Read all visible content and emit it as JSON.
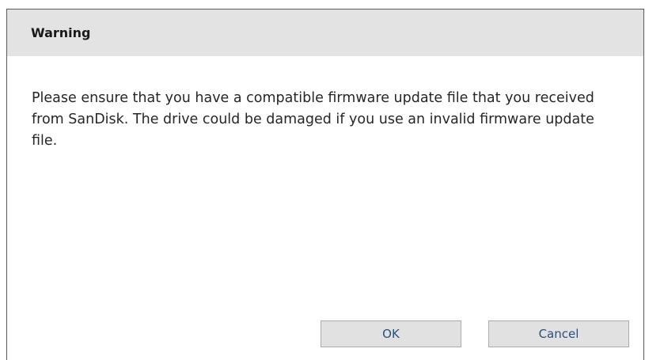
{
  "dialog": {
    "title": "Warning",
    "message": "Please ensure that you have a compatible firmware update file that you received from SanDisk. The drive could be damaged if you use an invalid firmware update file.",
    "buttons": {
      "ok_label": "OK",
      "cancel_label": "Cancel"
    }
  },
  "colors": {
    "titlebar_bg": "#e3e3e3",
    "button_bg": "#e1e1e1",
    "button_text": "#2b4f7e"
  }
}
